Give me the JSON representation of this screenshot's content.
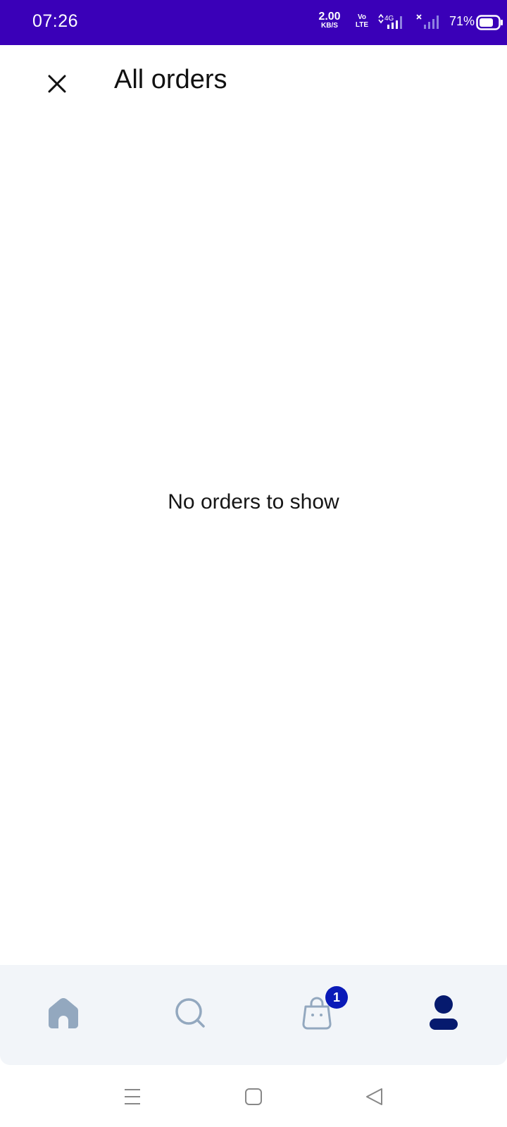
{
  "status_bar": {
    "time": "07:26",
    "net_speed_value": "2.00",
    "net_speed_unit": "KB/S",
    "volte_top": "Vo",
    "volte_bottom": "LTE",
    "network_type": "4G",
    "battery_percent": "71%",
    "background_color": "#3a00b8"
  },
  "header": {
    "title": "All orders",
    "close_icon": "close-icon"
  },
  "main": {
    "empty_message": "No orders to show"
  },
  "bottom_nav": {
    "items": [
      {
        "name": "home",
        "icon": "home-icon",
        "active": false
      },
      {
        "name": "search",
        "icon": "search-icon",
        "active": false
      },
      {
        "name": "bag",
        "icon": "shopping-bag-icon",
        "active": false,
        "badge": "1"
      },
      {
        "name": "profile",
        "icon": "user-icon",
        "active": true
      }
    ],
    "active_color": "#061a6e",
    "inactive_color": "#93a8bf",
    "badge_color": "#0a1ab8"
  },
  "system_nav": {
    "buttons": [
      "menu",
      "home",
      "back"
    ]
  }
}
